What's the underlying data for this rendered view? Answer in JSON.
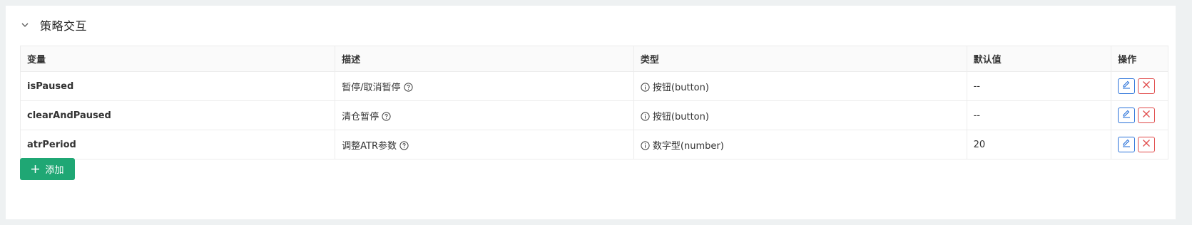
{
  "section": {
    "title": "策略交互",
    "chevron_icon": "chevron-down-icon"
  },
  "table": {
    "columns": {
      "variable": "变量",
      "description": "描述",
      "type": "类型",
      "default": "默认值",
      "actions": "操作"
    },
    "rows": [
      {
        "variable": "isPaused",
        "description": "暂停/取消暂停",
        "type": "按钮(button)",
        "default": "--"
      },
      {
        "variable": "clearAndPaused",
        "description": "清仓暂停",
        "type": "按钮(button)",
        "default": "--"
      },
      {
        "variable": "atrPeriod",
        "description": "调整ATR参数",
        "type": "数字型(number)",
        "default": "20"
      }
    ]
  },
  "add_button": {
    "label": "添加",
    "icon": "plus-icon"
  },
  "colors": {
    "accent_green": "#1fa774",
    "edit_blue": "#2a72d9",
    "delete_red": "#e04949"
  }
}
